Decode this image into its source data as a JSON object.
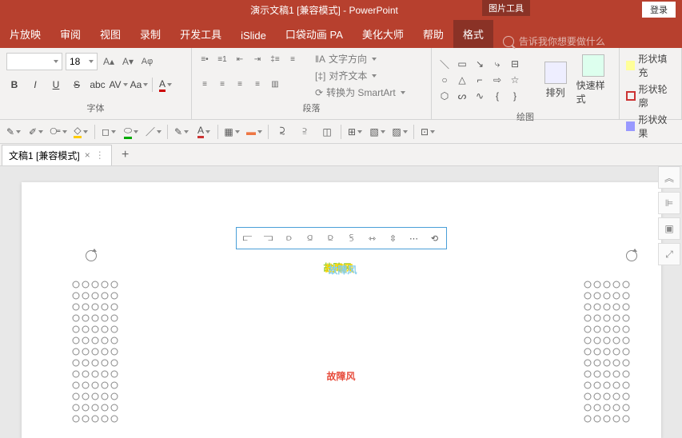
{
  "title": "演示文稿1 [兼容模式] - PowerPoint",
  "login_label": "登录",
  "contextual_tool": "图片工具",
  "tabs": [
    "片放映",
    "审阅",
    "视图",
    "录制",
    "开发工具",
    "iSlide",
    "口袋动画 PA",
    "美化大师",
    "帮助",
    "格式"
  ],
  "search_placeholder": "告诉我你想要做什么",
  "font": {
    "size": "18",
    "group_label": "字体",
    "buttons": {
      "bold": "B",
      "italic": "I",
      "underline": "U",
      "strike": "S",
      "shadow": "abc",
      "spacing": "AV",
      "case": "Aa",
      "color_label": "A"
    },
    "grow": "A",
    "shrink": "A",
    "clear": "Aφ"
  },
  "paragraph": {
    "group_label": "段落",
    "text_direction": "文字方向",
    "align_text": "对齐文本",
    "smartart": "转换为 SmartArt"
  },
  "drawing": {
    "group_label": "绘图",
    "arrange": "排列",
    "quick_styles": "快速样式",
    "shape_fill": "形状填充",
    "shape_outline": "形状轮廓",
    "shape_effects": "形状效果"
  },
  "doc_tab": "文稿1 [兼容模式]",
  "main_text": "故障风",
  "chart_data": null
}
